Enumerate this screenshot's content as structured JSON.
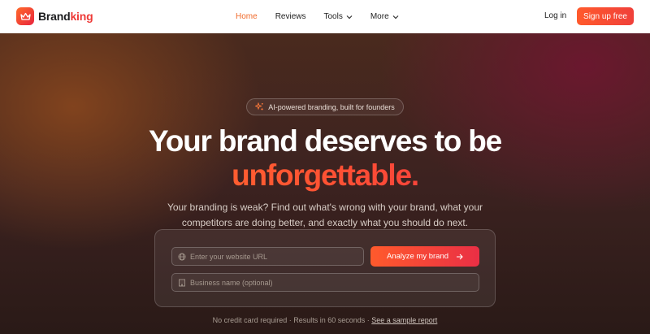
{
  "brand": {
    "name_part1": "Brand",
    "name_part2": "king",
    "accent": "#ee3a37",
    "icon": "crown-icon"
  },
  "nav": {
    "items": [
      {
        "label": "Home",
        "active": true
      },
      {
        "label": "Reviews",
        "active": false
      },
      {
        "label": "Tools",
        "active": false,
        "dropdown": true
      },
      {
        "label": "More",
        "active": false,
        "dropdown": true
      }
    ],
    "login_label": "Log in",
    "signup_label": "Sign up free"
  },
  "hero": {
    "badge": "AI-powered branding, built for founders",
    "badge_icon": "sparkles-icon",
    "headline_line1": "Your brand deserves to be",
    "headline_line2": "unforgettable.",
    "subtext_line1": "Your branding is weak? Find out what's wrong with your brand, what your",
    "subtext_line2": "competitors are doing better, and exactly what you should do next."
  },
  "form": {
    "url_placeholder": "Enter your website URL",
    "url_icon": "globe-icon",
    "business_placeholder": "Business name (optional)",
    "business_icon": "building-icon",
    "analyze_label": "Analyze my brand",
    "analyze_icon": "arrow-right-icon"
  },
  "footer_note": {
    "text": "No credit card required · Results in 60 seconds · ",
    "link": "See a sample report"
  },
  "colors": {
    "primary_orange": "#ff5a2c",
    "primary_red": "#e8243d",
    "active_nav": "#f06a2a"
  }
}
